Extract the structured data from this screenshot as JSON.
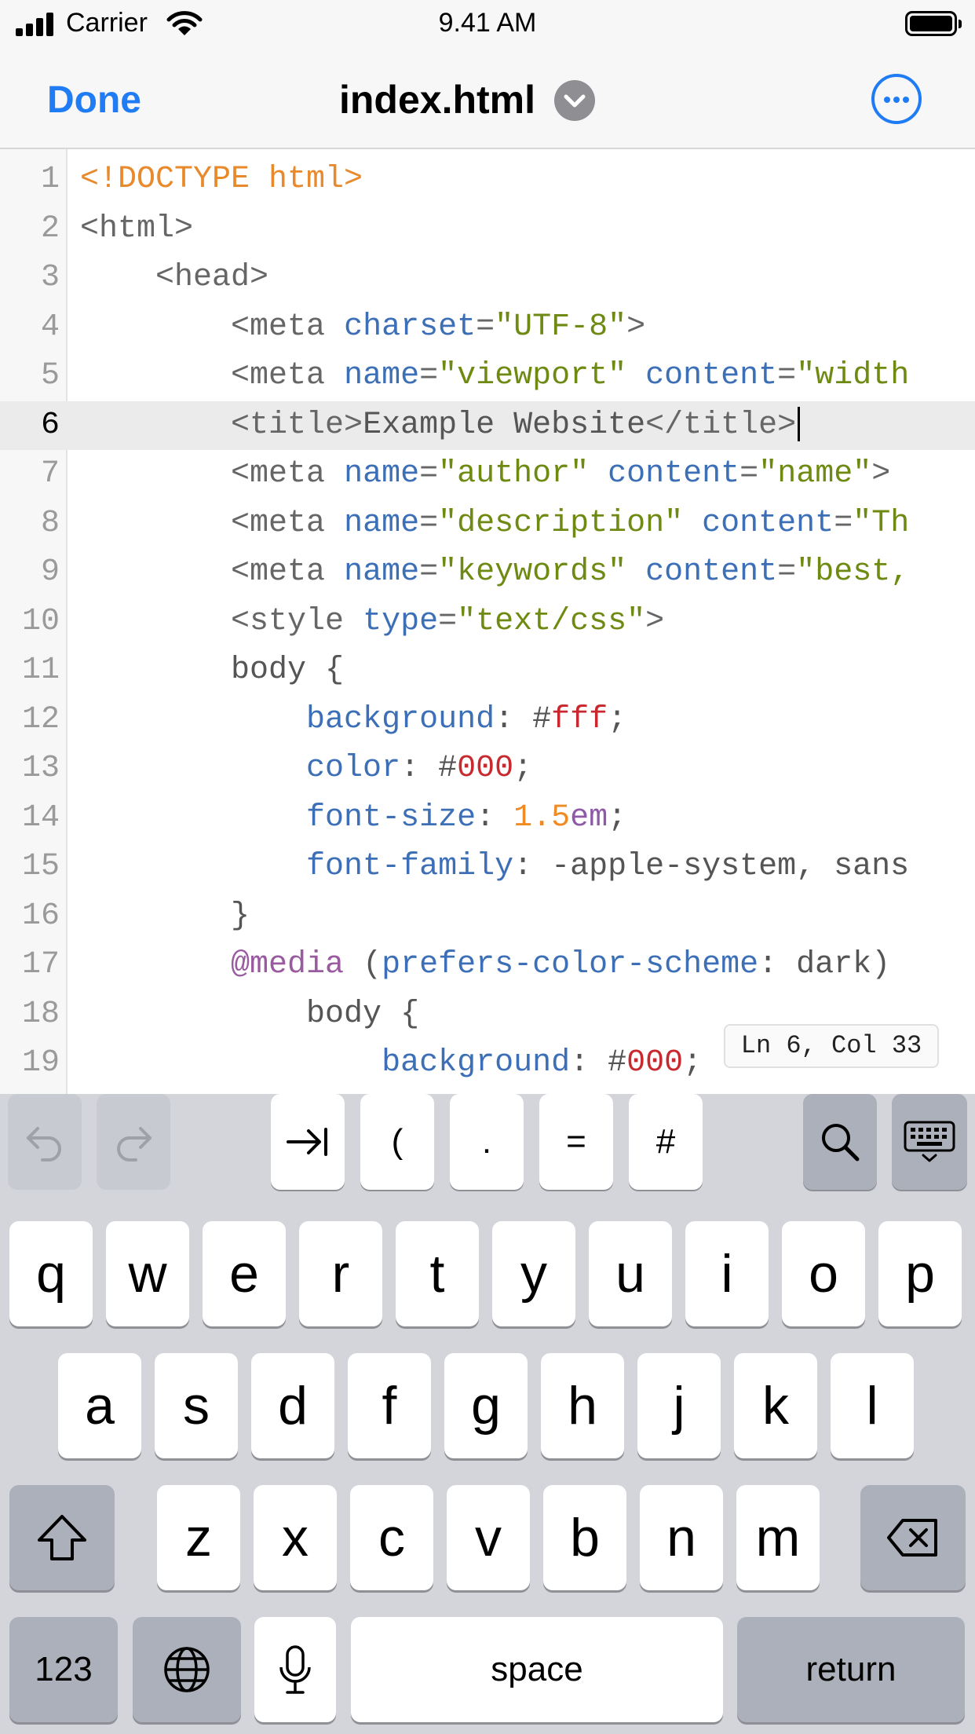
{
  "status_bar": {
    "carrier": "Carrier",
    "time": "9.41 AM"
  },
  "nav": {
    "done_label": "Done",
    "title": "index.html"
  },
  "editor": {
    "active_line": 6,
    "position_label": "Ln 6, Col 33",
    "lines": [
      {
        "n": "1",
        "tokens": [
          [
            "doc",
            "<!DOCTYPE html>"
          ]
        ]
      },
      {
        "n": "2",
        "tokens": [
          [
            "tag",
            "<html>"
          ]
        ]
      },
      {
        "n": "3",
        "tokens": [
          [
            "txt",
            "    "
          ],
          [
            "tag",
            "<head>"
          ]
        ]
      },
      {
        "n": "4",
        "tokens": [
          [
            "txt",
            "        "
          ],
          [
            "tag",
            "<meta "
          ],
          [
            "attr",
            "charset"
          ],
          [
            "tag",
            "="
          ],
          [
            "str",
            "\"UTF-8\""
          ],
          [
            "tag",
            ">"
          ]
        ]
      },
      {
        "n": "5",
        "tokens": [
          [
            "txt",
            "        "
          ],
          [
            "tag",
            "<meta "
          ],
          [
            "attr",
            "name"
          ],
          [
            "tag",
            "="
          ],
          [
            "str",
            "\"viewport\" "
          ],
          [
            "attr",
            "content"
          ],
          [
            "tag",
            "="
          ],
          [
            "str",
            "\"width"
          ]
        ]
      },
      {
        "n": "6",
        "tokens": [
          [
            "txt",
            "        "
          ],
          [
            "tag",
            "<title>"
          ],
          [
            "txt",
            "Example Website"
          ],
          [
            "tag",
            "</title>"
          ]
        ]
      },
      {
        "n": "7",
        "tokens": [
          [
            "txt",
            "        "
          ],
          [
            "tag",
            "<meta "
          ],
          [
            "attr",
            "name"
          ],
          [
            "tag",
            "="
          ],
          [
            "str",
            "\"author\" "
          ],
          [
            "attr",
            "content"
          ],
          [
            "tag",
            "="
          ],
          [
            "str",
            "\"name\""
          ],
          [
            "tag",
            ">"
          ]
        ]
      },
      {
        "n": "8",
        "tokens": [
          [
            "txt",
            "        "
          ],
          [
            "tag",
            "<meta "
          ],
          [
            "attr",
            "name"
          ],
          [
            "tag",
            "="
          ],
          [
            "str",
            "\"description\" "
          ],
          [
            "attr",
            "content"
          ],
          [
            "tag",
            "="
          ],
          [
            "str",
            "\"Th"
          ]
        ]
      },
      {
        "n": "9",
        "tokens": [
          [
            "txt",
            "        "
          ],
          [
            "tag",
            "<meta "
          ],
          [
            "attr",
            "name"
          ],
          [
            "tag",
            "="
          ],
          [
            "str",
            "\"keywords\" "
          ],
          [
            "attr",
            "content"
          ],
          [
            "tag",
            "="
          ],
          [
            "str",
            "\"best,"
          ]
        ]
      },
      {
        "n": "10",
        "tokens": [
          [
            "txt",
            "        "
          ],
          [
            "tag",
            "<style "
          ],
          [
            "attr",
            "type"
          ],
          [
            "tag",
            "="
          ],
          [
            "str",
            "\"text/css\""
          ],
          [
            "tag",
            ">"
          ]
        ]
      },
      {
        "n": "11",
        "tokens": [
          [
            "txt",
            "        body {"
          ]
        ]
      },
      {
        "n": "12",
        "tokens": [
          [
            "txt",
            "            "
          ],
          [
            "attr",
            "background"
          ],
          [
            "txt",
            ": #"
          ],
          [
            "hex",
            "fff"
          ],
          [
            "txt",
            ";"
          ]
        ]
      },
      {
        "n": "13",
        "tokens": [
          [
            "txt",
            "            "
          ],
          [
            "attr",
            "color"
          ],
          [
            "txt",
            ": #"
          ],
          [
            "hex",
            "000"
          ],
          [
            "txt",
            ";"
          ]
        ]
      },
      {
        "n": "14",
        "tokens": [
          [
            "txt",
            "            "
          ],
          [
            "attr",
            "font-size"
          ],
          [
            "txt",
            ": "
          ],
          [
            "num",
            "1.5"
          ],
          [
            "unit",
            "em"
          ],
          [
            "txt",
            ";"
          ]
        ]
      },
      {
        "n": "15",
        "tokens": [
          [
            "txt",
            "            "
          ],
          [
            "attr",
            "font-family"
          ],
          [
            "txt",
            ": -apple-system, sans"
          ]
        ]
      },
      {
        "n": "16",
        "tokens": [
          [
            "txt",
            "        }"
          ]
        ]
      },
      {
        "n": "17",
        "tokens": [
          [
            "txt",
            "        "
          ],
          [
            "at",
            "@media"
          ],
          [
            "txt",
            " ("
          ],
          [
            "attr",
            "prefers-color-scheme"
          ],
          [
            "txt",
            ": dark)"
          ]
        ]
      },
      {
        "n": "18",
        "tokens": [
          [
            "txt",
            "            body {"
          ]
        ]
      },
      {
        "n": "19",
        "tokens": [
          [
            "txt",
            "                "
          ],
          [
            "attr",
            "background"
          ],
          [
            "txt",
            ": #"
          ],
          [
            "hex",
            "000"
          ],
          [
            "txt",
            ";"
          ]
        ]
      }
    ]
  },
  "accessory": {
    "keys": [
      "(",
      ".",
      "=",
      "#"
    ]
  },
  "keyboard": {
    "row1": [
      "q",
      "w",
      "e",
      "r",
      "t",
      "y",
      "u",
      "i",
      "o",
      "p"
    ],
    "row2": [
      "a",
      "s",
      "d",
      "f",
      "g",
      "h",
      "j",
      "k",
      "l"
    ],
    "row3": [
      "z",
      "x",
      "c",
      "v",
      "b",
      "n",
      "m"
    ],
    "numbers_label": "123",
    "space_label": "space",
    "return_label": "return"
  },
  "colors": {
    "accent": "#1f7cf5",
    "keyboard_bg": "#d3d5db",
    "function_key": "#abb0ba"
  }
}
